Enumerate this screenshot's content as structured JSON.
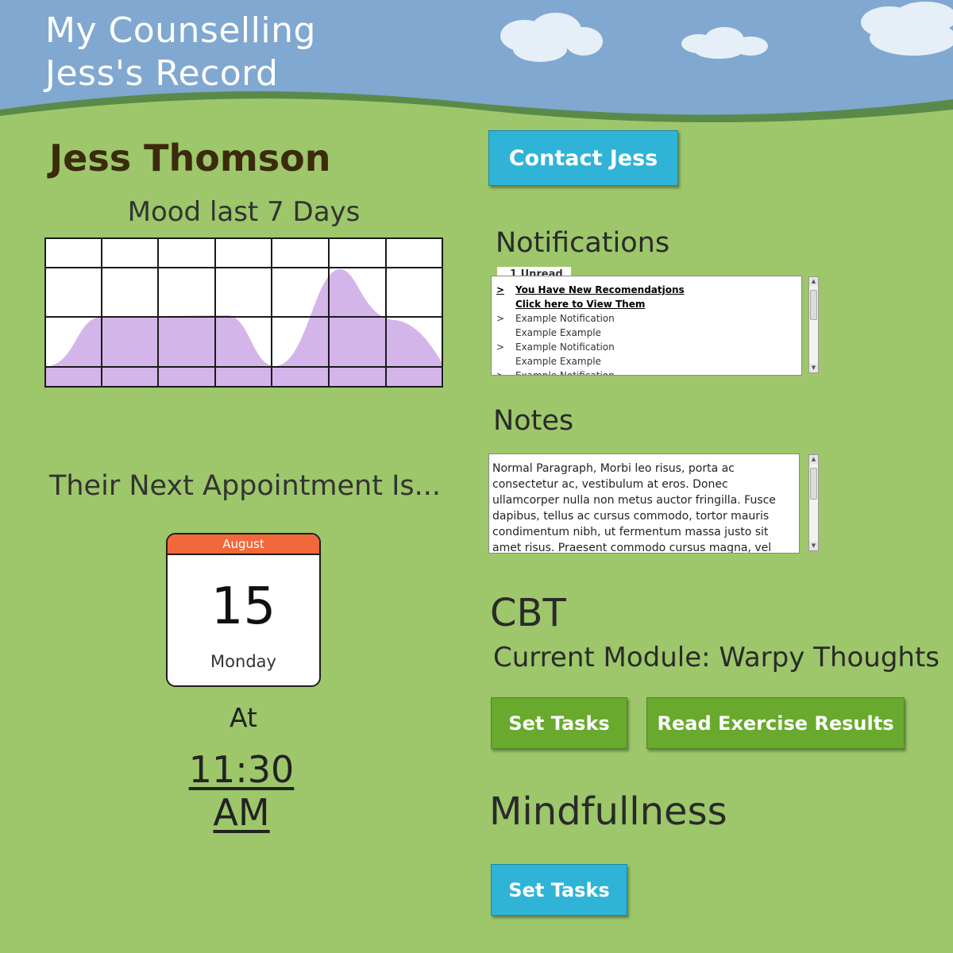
{
  "header": {
    "app_name": "My Counselling",
    "record_title": "Jess's Record"
  },
  "client": {
    "name": "Jess Thomson"
  },
  "mood": {
    "title": "Mood last 7 Days",
    "fill_color": "#d4b5ea"
  },
  "appointment": {
    "heading": "Their Next Appointment Is...",
    "month": "August",
    "day": "15",
    "weekday": "Monday",
    "at_label": "At",
    "time": "11:30 AM"
  },
  "contact_button": {
    "label": "Contact Jess"
  },
  "notifications": {
    "heading": "Notifications",
    "unread_tab": "1 Unread",
    "items": [
      {
        "marker": ">",
        "text": "You Have New Recomendatjons"
      },
      {
        "marker": "",
        "text": "Click here to View Them"
      },
      {
        "marker": ">",
        "text": "Example Notification"
      },
      {
        "marker": "",
        "text": "Example Example"
      },
      {
        "marker": ">",
        "text": "Example Notification"
      },
      {
        "marker": "",
        "text": "Example Example"
      },
      {
        "marker": ">",
        "text": "Example Notification"
      }
    ]
  },
  "notes": {
    "heading": "Notes",
    "text": "Normal Paragraph, Morbi leo risus, porta ac consectetur ac, vestibulum at eros. Donec ullamcorper nulla non metus auctor fringilla. Fusce dapibus, tellus ac cursus commodo, tortor mauris condimentum nibh, ut fermentum massa justo sit amet risus. Praesent commodo cursus magna, vel scelerisque nisl consectetur"
  },
  "cbt": {
    "heading": "CBT",
    "current_module": "Current Module: Warpy Thoughts",
    "set_tasks_label": "Set Tasks",
    "read_results_label": "Read Exercise Results"
  },
  "mindfulness": {
    "heading": "Mindfullness",
    "set_tasks_label": "Set Tasks"
  },
  "colors": {
    "sky": "#80a8d0",
    "grass": "#9dc76a",
    "hill_dark": "#5a8a4a",
    "button_blue": "#2fb4d8",
    "button_green": "#68a92e",
    "calendar_header": "#f2683b"
  }
}
